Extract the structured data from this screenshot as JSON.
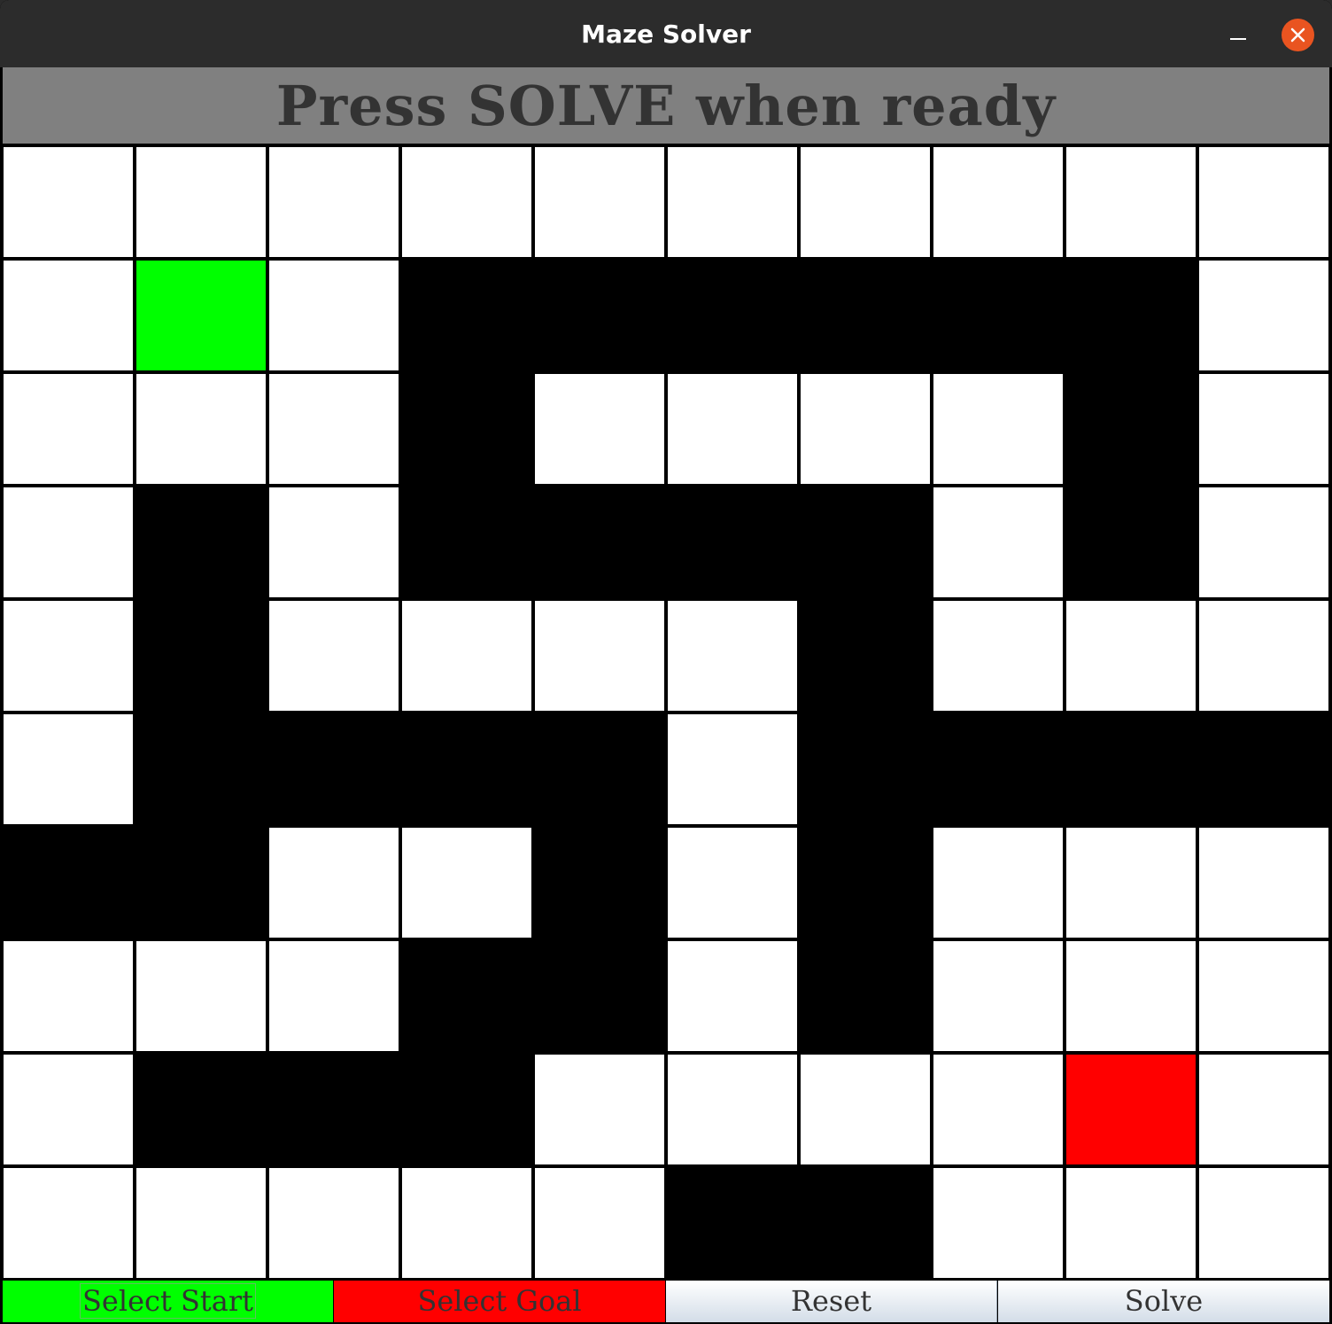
{
  "window": {
    "title": "Maze Solver"
  },
  "status": {
    "message": "Press SOLVE when ready"
  },
  "maze": {
    "rows": 10,
    "cols": 10,
    "legend": {
      "0": "open",
      "1": "wall",
      "S": "start",
      "G": "goal"
    },
    "colors": {
      "open": "#ffffff",
      "wall": "#000000",
      "start": "#00ff00",
      "goal": "#ff0000"
    },
    "cells": [
      [
        "0",
        "0",
        "0",
        "0",
        "0",
        "0",
        "0",
        "0",
        "0",
        "0"
      ],
      [
        "0",
        "S",
        "0",
        "1",
        "1",
        "1",
        "1",
        "1",
        "1",
        "0"
      ],
      [
        "0",
        "0",
        "0",
        "1",
        "0",
        "0",
        "0",
        "0",
        "1",
        "0"
      ],
      [
        "0",
        "1",
        "0",
        "1",
        "1",
        "1",
        "1",
        "0",
        "1",
        "0"
      ],
      [
        "0",
        "1",
        "0",
        "0",
        "0",
        "0",
        "1",
        "0",
        "0",
        "0"
      ],
      [
        "0",
        "1",
        "1",
        "1",
        "1",
        "0",
        "1",
        "1",
        "1",
        "1"
      ],
      [
        "1",
        "1",
        "0",
        "0",
        "1",
        "0",
        "1",
        "0",
        "0",
        "0"
      ],
      [
        "0",
        "0",
        "0",
        "1",
        "1",
        "0",
        "1",
        "0",
        "0",
        "0"
      ],
      [
        "0",
        "1",
        "1",
        "1",
        "0",
        "0",
        "0",
        "0",
        "G",
        "0"
      ],
      [
        "0",
        "0",
        "0",
        "0",
        "0",
        "1",
        "1",
        "0",
        "0",
        "0"
      ]
    ]
  },
  "buttons": {
    "select_start": "Select Start",
    "select_goal": "Select Goal",
    "reset": "Reset",
    "solve": "Solve"
  },
  "icons": {
    "minimize": "minimize-icon",
    "close": "close-icon"
  }
}
